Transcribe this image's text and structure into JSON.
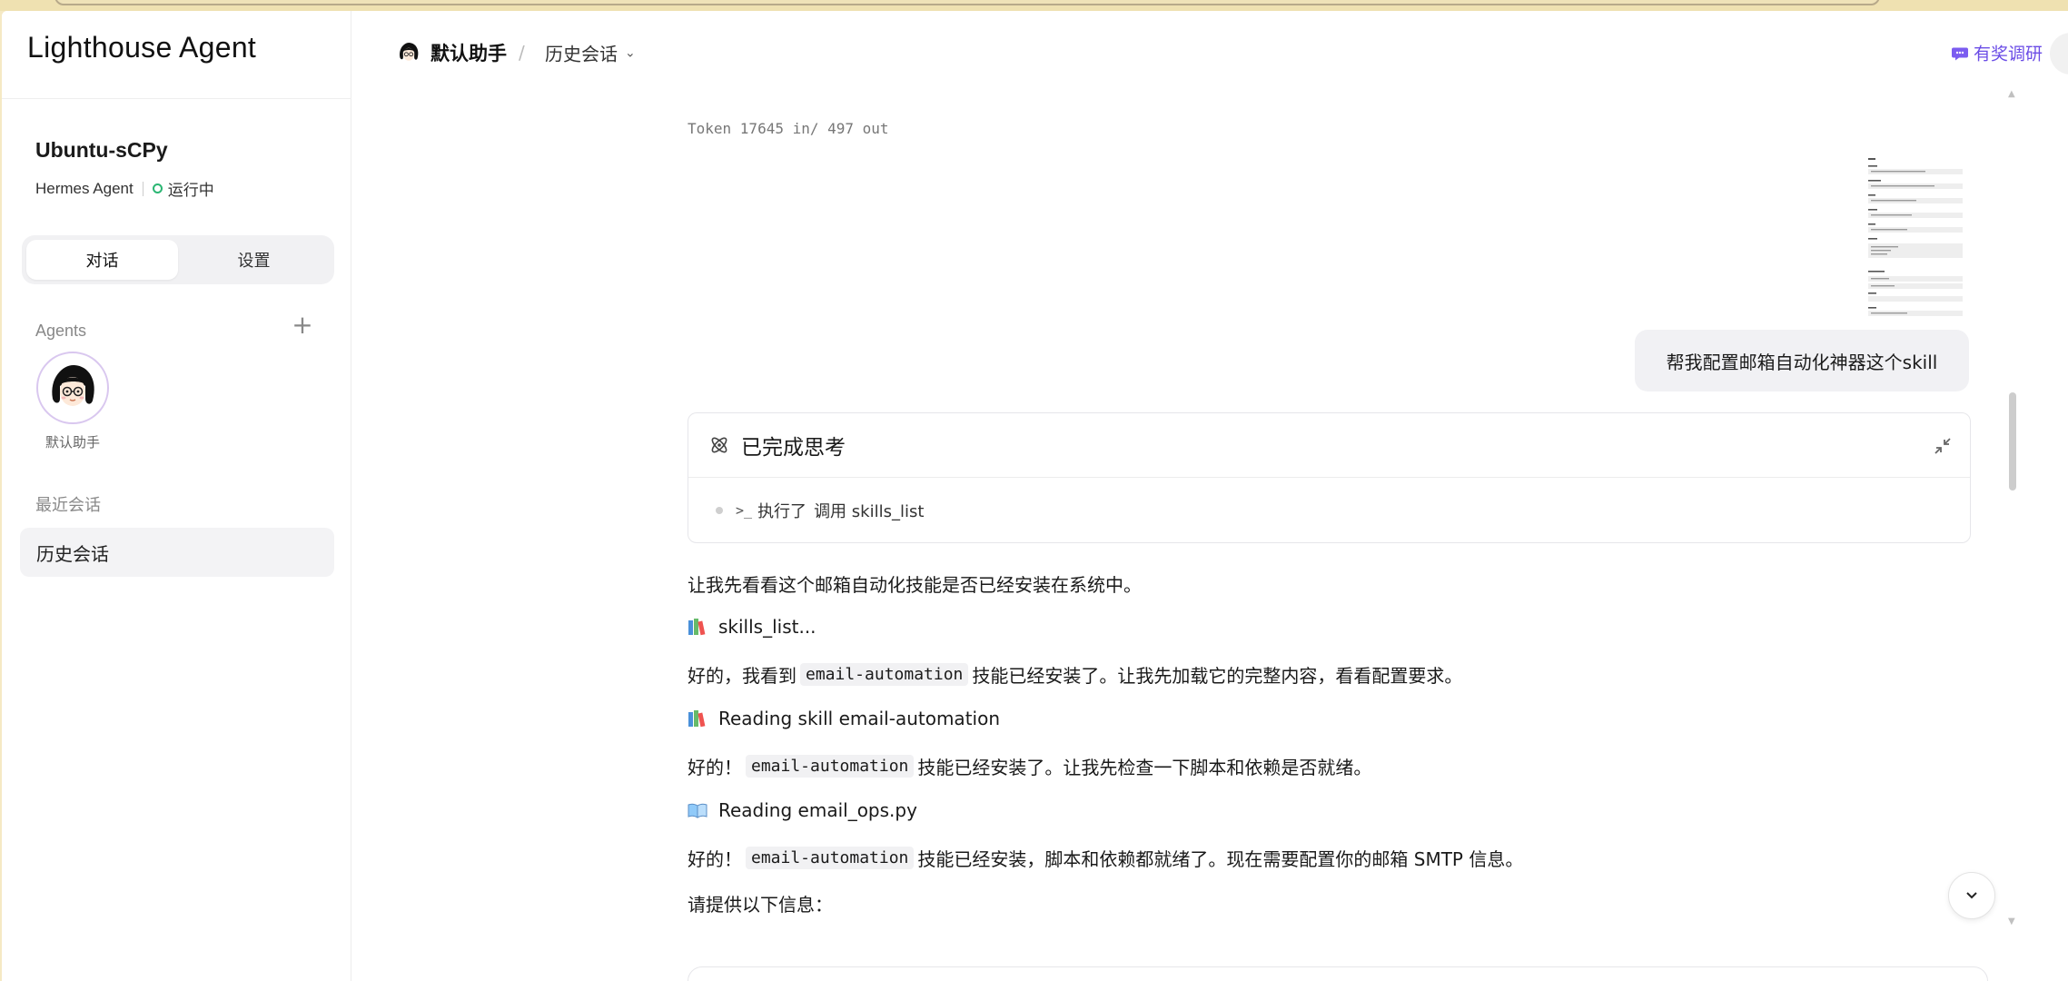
{
  "app": {
    "brand": "Lighthouse Agent"
  },
  "sidebar": {
    "instance_name": "Ubuntu-sCPy",
    "instance_type": "Hermes Agent",
    "status": "运行中",
    "tabs": [
      {
        "label": "对话",
        "active": true
      },
      {
        "label": "设置",
        "active": false
      }
    ],
    "agents_label": "Agents",
    "agents": [
      {
        "name": "默认助手"
      }
    ],
    "recent_label": "最近会话",
    "recent_items": [
      {
        "label": "历史会话"
      }
    ]
  },
  "header": {
    "agent_name": "默认助手",
    "separator": "/",
    "history_label": "历史会话",
    "survey_label": "有奖调研",
    "accent_color": "#6b4de6"
  },
  "chat": {
    "token_info": "Token 17645 in/ 497 out",
    "user_message": "帮我配置邮箱自动化神器这个skill",
    "thinking": {
      "title": "已完成思考",
      "step_prefix": "执行了",
      "step_text": "调用 skills_list"
    },
    "messages": {
      "m1": "让我先看看这个邮箱自动化技能是否已经安装在系统中。",
      "t1": "skills_list...",
      "m2_pre": "好的，我看到",
      "m2_code": "email-automation",
      "m2_post": "技能已经安装了。让我先加载它的完整内容，看看配置要求。",
      "t2": "Reading skill email-automation",
      "m3_pre": "好的！",
      "m3_code": "email-automation",
      "m3_post": "技能已经安装了。让我先检查一下脚本和依赖是否就绪。",
      "t3": "Reading email_ops.py",
      "m4_pre": "好的！",
      "m4_code": "email-automation",
      "m4_post": "技能已经安装，脚本和依赖都就绪了。现在需要配置你的邮箱 SMTP 信息。",
      "m5": "请提供以下信息："
    }
  }
}
